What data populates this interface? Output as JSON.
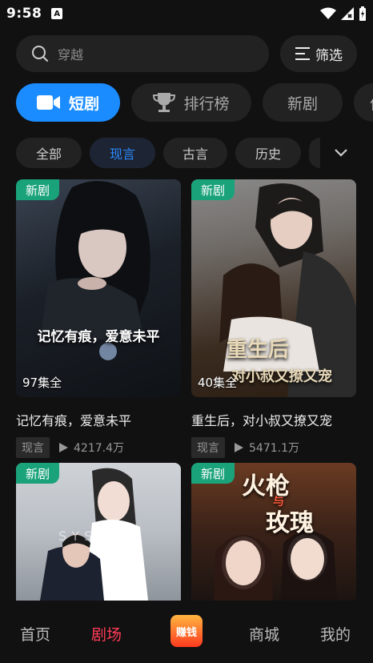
{
  "status_bar": {
    "time": "9:58",
    "notification_icon": "A"
  },
  "search": {
    "placeholder": "穿越",
    "filter_label": "筛选"
  },
  "tabs": [
    {
      "label": "短剧"
    },
    {
      "label": "排行榜"
    },
    {
      "label": "新剧"
    },
    {
      "label": "优"
    }
  ],
  "genres": [
    "全部",
    "现言",
    "古言",
    "历史"
  ],
  "cards": [
    {
      "badge": "新剧",
      "episodes": "97集全",
      "poster_text": "记忆有痕，爱意未平",
      "title": "记忆有痕，爱意未平",
      "tag": "现言",
      "plays": "4217.4万"
    },
    {
      "badge": "新剧",
      "episodes": "40集全",
      "poster_text_1": "重生后",
      "poster_text_2": "对小叔又撩又宠",
      "title": "重生后，对小叔又撩又宠",
      "tag": "现言",
      "plays": "5471.1万"
    },
    {
      "badge": "新剧",
      "poster_text": "SYSTEM"
    },
    {
      "badge": "新剧",
      "poster_text_1": "火枪",
      "poster_text_2": "与",
      "poster_text_3": "玫瑰"
    }
  ],
  "bottom_nav": {
    "home": "首页",
    "theater": "剧场",
    "earn": "赚钱",
    "mall": "商城",
    "mine": "我的"
  },
  "colors": {
    "accent": "#1a8cff",
    "badge": "#1aa37a",
    "nav_active": "#ff3b57"
  }
}
